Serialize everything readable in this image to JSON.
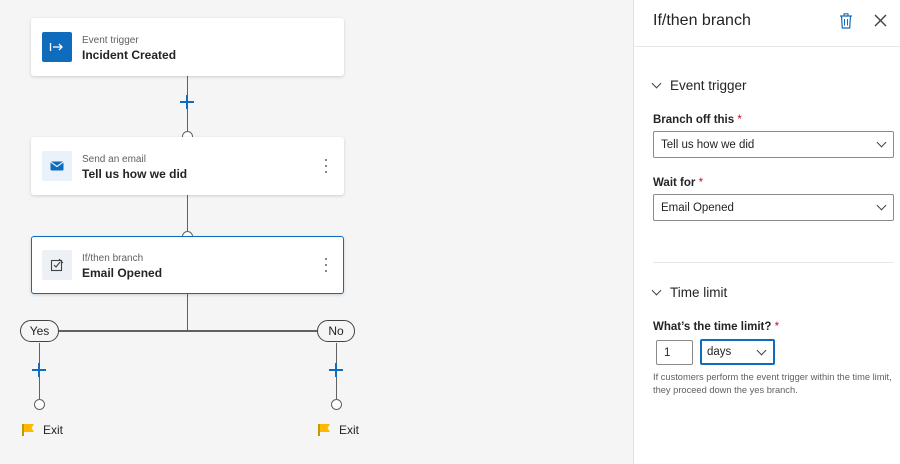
{
  "canvas": {
    "cards": [
      {
        "label": "Event trigger",
        "title": "Incident Created",
        "icon": "event-trigger-icon"
      },
      {
        "label": "Send an email",
        "title": "Tell us how we did",
        "icon": "email-icon"
      },
      {
        "label": "If/then branch",
        "title": "Email Opened",
        "icon": "branch-icon"
      }
    ],
    "branches": {
      "yes_label": "Yes",
      "no_label": "No"
    },
    "exits": [
      {
        "label": "Exit"
      },
      {
        "label": "Exit"
      }
    ]
  },
  "panel": {
    "title": "If/then branch",
    "event_section": {
      "heading": "Event trigger",
      "branch_label": "Branch off this",
      "branch_value": "Tell us how we did",
      "wait_label": "Wait for",
      "wait_value": "Email Opened",
      "required_marker": "*"
    },
    "time_section": {
      "heading": "Time limit",
      "limit_label": "What’s the time limit?",
      "required_marker": "*",
      "amount": "1",
      "unit": "days",
      "help_text": "If customers perform the event trigger within the time limit, they proceed down the yes branch."
    }
  },
  "colors": {
    "accent": "#0f6cbd",
    "canvas_bg": "#f5f5f5",
    "required": "#c50f1f",
    "exit_flag": "#ffb900"
  }
}
